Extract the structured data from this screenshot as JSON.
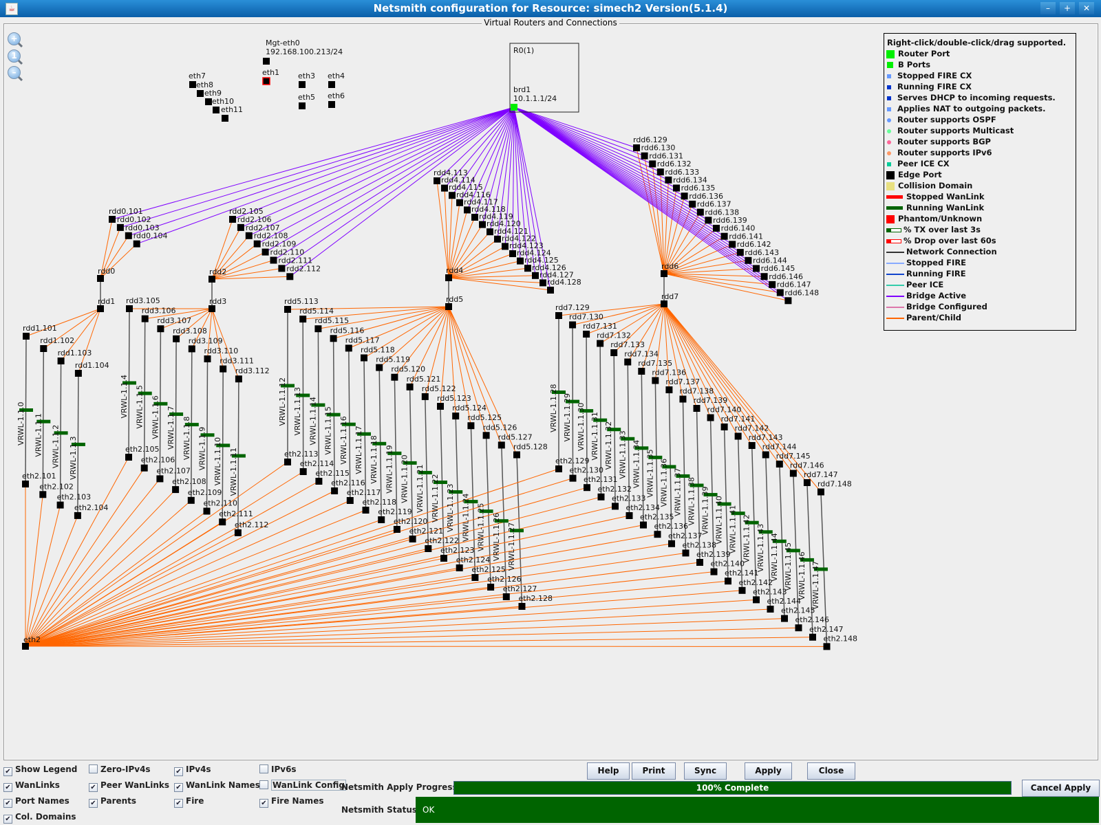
{
  "window": {
    "title": "Netsmith configuration for Resource:  simech2  Version(5.1.4)",
    "controls": [
      "minimize-icon",
      "maximize-icon",
      "close-icon"
    ]
  },
  "canvas": {
    "title": "Virtual Routers and Connections",
    "zoom_tools": [
      "zoom-in-icon",
      "zoom-reset-icon",
      "zoom-out-icon"
    ],
    "colors": {
      "bridge_active": "#7f00ff",
      "parent_child": "#ff6600",
      "network_connection": "#555555",
      "running_wanlink": "#006400",
      "router_port": "#00ee00",
      "edge_port": "#000000",
      "phantom": "#ff0000"
    },
    "router_box": {
      "name": "R0(1)",
      "port_name": "brd1",
      "port_ip": "10.1.1.1/24"
    },
    "mgmt_port": {
      "name": "Mgt-eth0",
      "ip": "192.168.100.213/24"
    },
    "loose_ports": [
      "eth1",
      "eth3",
      "eth4",
      "eth5",
      "eth6",
      "eth7",
      "eth8",
      "eth9",
      "eth10",
      "eth11"
    ],
    "phantom_ports": [
      "eth1"
    ],
    "hub_port": "eth2",
    "groups": [
      {
        "bridge_router": "rdd0",
        "wan_router": "rdd1",
        "bridge_ports": [
          "rdd0.101",
          "rdd0.102",
          "rdd0.103",
          "rdd0.104"
        ],
        "wan_ports": [
          "rdd1.101",
          "rdd1.102",
          "rdd1.103",
          "rdd1.104"
        ],
        "wanlinks": [
          "VRWL-1.1.0",
          "VRWL-1.1.1",
          "VRWL-1.1.2",
          "VRWL-1.1.3"
        ],
        "eth_ports": [
          "eth2.101",
          "eth2.102",
          "eth2.103",
          "eth2.104"
        ]
      },
      {
        "bridge_router": "rdd2",
        "wan_router": "rdd3",
        "bridge_ports": [
          "rdd2.105",
          "rdd2.106",
          "rdd2.107",
          "rdd2.108",
          "rdd2.109",
          "rdd2.110",
          "rdd2.111",
          "rdd2.112"
        ],
        "wan_ports": [
          "rdd3.105",
          "rdd3.106",
          "rdd3.107",
          "rdd3.108",
          "rdd3.109",
          "rdd3.110",
          "rdd3.111",
          "rdd3.112"
        ],
        "wanlinks": [
          "VRWL-1.1.4",
          "VRWL-1.1.5",
          "VRWL-1.1.6",
          "VRWL-1.1.7",
          "VRWL-1.1.8",
          "VRWL-1.1.9",
          "VRWL-1.1.10",
          "VRWL-1.1.11"
        ],
        "eth_ports": [
          "eth2.105",
          "eth2.106",
          "eth2.107",
          "eth2.108",
          "eth2.109",
          "eth2.110",
          "eth2.111",
          "eth2.112"
        ]
      },
      {
        "bridge_router": "rdd4",
        "wan_router": "rdd5",
        "bridge_ports": [
          "rdd4.113",
          "rdd4.114",
          "rdd4.115",
          "rdd4.116",
          "rdd4.117",
          "rdd4.118",
          "rdd4.119",
          "rdd4.120",
          "rdd4.121",
          "rdd4.122",
          "rdd4.123",
          "rdd4.124",
          "rdd4.125",
          "rdd4.126",
          "rdd4.127",
          "rdd4.128"
        ],
        "wan_ports": [
          "rdd5.113",
          "rdd5.114",
          "rdd5.115",
          "rdd5.116",
          "rdd5.117",
          "rdd5.118",
          "rdd5.119",
          "rdd5.120",
          "rdd5.121",
          "rdd5.122",
          "rdd5.123",
          "rdd5.124",
          "rdd5.125",
          "rdd5.126",
          "rdd5.127",
          "rdd5.128"
        ],
        "wanlinks": [
          "VRWL-1.1.12",
          "VRWL-1.1.13",
          "VRWL-1.1.14",
          "VRWL-1.1.15",
          "VRWL-1.1.16",
          "VRWL-1.1.17",
          "VRWL-1.1.18",
          "VRWL-1.1.19",
          "VRWL-1.1.20",
          "VRWL-1.1.21",
          "VRWL-1.1.22",
          "VRWL-1.1.23",
          "VRWL-1.1.24",
          "VRWL-1.1.25",
          "VRWL-1.1.26",
          "VRWL-1.1.27"
        ],
        "eth_ports": [
          "eth2.113",
          "eth2.114",
          "eth2.115",
          "eth2.116",
          "eth2.117",
          "eth2.118",
          "eth2.119",
          "eth2.120",
          "eth2.121",
          "eth2.122",
          "eth2.123",
          "eth2.124",
          "eth2.125",
          "eth2.126",
          "eth2.127",
          "eth2.128"
        ]
      },
      {
        "bridge_router": "rdd6",
        "wan_router": "rdd7",
        "bridge_ports": [
          "rdd6.129",
          "rdd6.130",
          "rdd6.131",
          "rdd6.132",
          "rdd6.133",
          "rdd6.134",
          "rdd6.135",
          "rdd6.136",
          "rdd6.137",
          "rdd6.138",
          "rdd6.139",
          "rdd6.140",
          "rdd6.141",
          "rdd6.142",
          "rdd6.143",
          "rdd6.144",
          "rdd6.145",
          "rdd6.146",
          "rdd6.147",
          "rdd6.148"
        ],
        "wan_ports": [
          "rdd7.129",
          "rdd7.130",
          "rdd7.131",
          "rdd7.132",
          "rdd7.133",
          "rdd7.134",
          "rdd7.135",
          "rdd7.136",
          "rdd7.137",
          "rdd7.138",
          "rdd7.139",
          "rdd7.140",
          "rdd7.141",
          "rdd7.142",
          "rdd7.143",
          "rdd7.144",
          "rdd7.145",
          "rdd7.146",
          "rdd7.147",
          "rdd7.148"
        ],
        "wanlinks": [
          "VRWL-1.1.28",
          "VRWL-1.1.29",
          "VRWL-1.1.30",
          "VRWL-1.1.31",
          "VRWL-1.1.32",
          "VRWL-1.1.33",
          "VRWL-1.1.34",
          "VRWL-1.1.35",
          "VRWL-1.1.36",
          "VRWL-1.1.37",
          "VRWL-1.1.38",
          "VRWL-1.1.39",
          "VRWL-1.1.40",
          "VRWL-1.1.41",
          "VRWL-1.1.42",
          "VRWL-1.1.43",
          "VRWL-1.1.44",
          "VRWL-1.1.45",
          "VRWL-1.1.46",
          "VRWL-1.1.47"
        ],
        "eth_ports": [
          "eth2.129",
          "eth2.130",
          "eth2.131",
          "eth2.132",
          "eth2.133",
          "eth2.134",
          "eth2.135",
          "eth2.136",
          "eth2.137",
          "eth2.138",
          "eth2.139",
          "eth2.140",
          "eth2.141",
          "eth2.142",
          "eth2.143",
          "eth2.144",
          "eth2.145",
          "eth2.146",
          "eth2.147",
          "eth2.148"
        ]
      }
    ]
  },
  "legend": {
    "header": "Right-click/double-click/drag supported.",
    "items": [
      {
        "label": "Router Port",
        "swatch": "big-square",
        "color": "#00ee00"
      },
      {
        "label": "B Ports",
        "swatch": "square",
        "color": "#00ee00"
      },
      {
        "label": "Stopped FIRE CX",
        "swatch": "small-square",
        "color": "#6699ff"
      },
      {
        "label": "Running FIRE CX",
        "swatch": "small-square",
        "color": "#0033cc"
      },
      {
        "label": "Serves DHCP to incoming requests.",
        "swatch": "small-square",
        "color": "#0033cc"
      },
      {
        "label": "Applies NAT to outgoing packets.",
        "swatch": "small-square",
        "color": "#6699ff"
      },
      {
        "label": "Router supports OSPF",
        "swatch": "dot",
        "color": "#6699ff"
      },
      {
        "label": "Router supports Multicast",
        "swatch": "dot",
        "color": "#66ff99"
      },
      {
        "label": "Router supports BGP",
        "swatch": "dot",
        "color": "#ff6699"
      },
      {
        "label": "Router supports IPv6",
        "swatch": "dot",
        "color": "#ff9966"
      },
      {
        "label": "Peer ICE CX",
        "swatch": "small-square",
        "color": "#00cc99"
      },
      {
        "label": "Edge Port",
        "swatch": "big-square",
        "color": "#000000"
      },
      {
        "label": "Collision Domain",
        "swatch": "big-square",
        "color": "#e8e080"
      },
      {
        "label": "Stopped WanLink",
        "swatch": "bar",
        "color": "#ff0000"
      },
      {
        "label": "Running WanLink",
        "swatch": "bar",
        "color": "#006400"
      },
      {
        "label": "Phantom/Unknown",
        "swatch": "big-square",
        "color": "#ff0000"
      },
      {
        "label": "% TX over last 3s",
        "swatch": "outline-bar",
        "color": "#006400"
      },
      {
        "label": "% Drop over last 60s",
        "swatch": "outline-bar",
        "color": "#ff0000"
      },
      {
        "label": "Network Connection",
        "swatch": "line",
        "color": "#333333"
      },
      {
        "label": "Stopped FIRE",
        "swatch": "line",
        "color": "#88aaff"
      },
      {
        "label": "Running FIRE",
        "swatch": "line",
        "color": "#1144cc"
      },
      {
        "label": "Peer ICE",
        "swatch": "line",
        "color": "#33ccaa"
      },
      {
        "label": "Bridge Active",
        "swatch": "line",
        "color": "#7f00ff"
      },
      {
        "label": "Bridge Configured",
        "swatch": "line",
        "color": "#dd77aa"
      },
      {
        "label": "Parent/Child",
        "swatch": "line",
        "color": "#ff6600"
      }
    ]
  },
  "options": [
    {
      "label": "Show Legend",
      "checked": true
    },
    {
      "label": "Zero-IPv4s",
      "checked": false
    },
    {
      "label": "IPv4s",
      "checked": true
    },
    {
      "label": "IPv6s",
      "checked": false
    },
    {
      "label": "WanLinks",
      "checked": true
    },
    {
      "label": "Peer WanLinks",
      "checked": true
    },
    {
      "label": "WanLink Names",
      "checked": true
    },
    {
      "label": "WanLink Config",
      "checked": false
    },
    {
      "label": "Port Names",
      "checked": true
    },
    {
      "label": "Parents",
      "checked": true
    },
    {
      "label": "Fire",
      "checked": true
    },
    {
      "label": "Fire Names",
      "checked": true
    },
    {
      "label": "Col. Domains",
      "checked": true
    }
  ],
  "buttons": {
    "help": "Help",
    "print": "Print",
    "sync": "Sync",
    "apply": "Apply",
    "close": "Close",
    "cancel_apply": "Cancel Apply"
  },
  "progress": {
    "label": "Netsmith Apply Progress:",
    "text": "100% Complete",
    "percent": 100
  },
  "status": {
    "label": "Netsmith Status:",
    "text": "OK"
  }
}
